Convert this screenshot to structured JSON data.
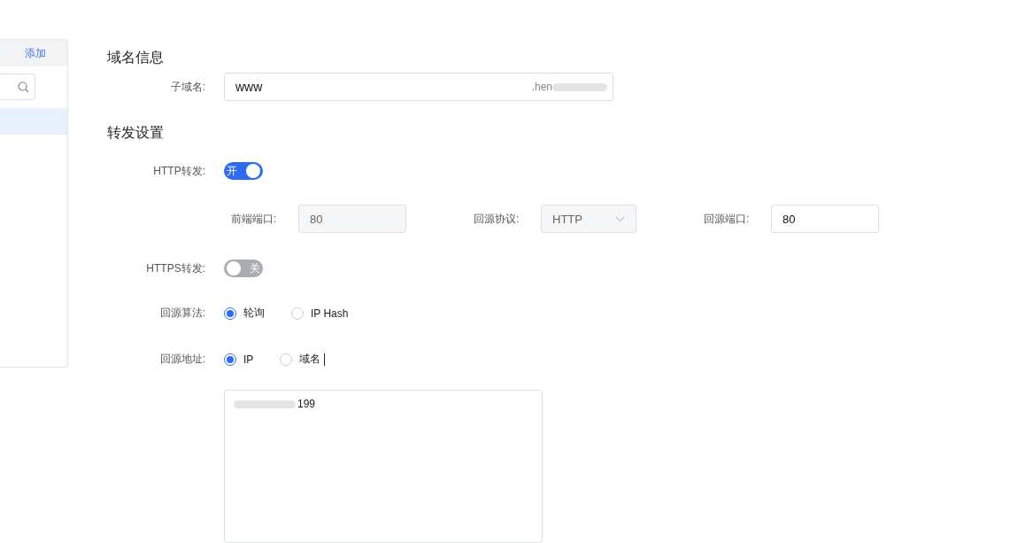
{
  "sidebar": {
    "add_link": "添加",
    "items": [
      {
        "selected": true
      }
    ]
  },
  "sections": [
    {
      "title": "域名信息"
    },
    {
      "title": "转发设置"
    }
  ],
  "subdomain": {
    "label": "子域名:",
    "value": "www",
    "suffix": ".hen"
  },
  "http": {
    "label": "HTTP转发:",
    "on": true,
    "switch_text": "开"
  },
  "ports": [
    {
      "label": "前端端口:",
      "value": "80",
      "kind": "readonly"
    },
    {
      "label": "回源协议:",
      "value": "HTTP",
      "kind": "select"
    },
    {
      "label": "回源端口:",
      "value": "80",
      "kind": "input"
    }
  ],
  "https": {
    "label": "HTTPS转发:",
    "on": false,
    "switch_text": "关"
  },
  "algorithm": {
    "label": "回源算法:",
    "options": [
      {
        "label": "轮询",
        "selected": true
      },
      {
        "label": "IP Hash",
        "selected": false
      }
    ]
  },
  "origin": {
    "label": "回源地址:",
    "options": [
      {
        "label": "IP",
        "selected": true
      },
      {
        "label": "域名",
        "selected": false
      }
    ],
    "value": "199"
  }
}
